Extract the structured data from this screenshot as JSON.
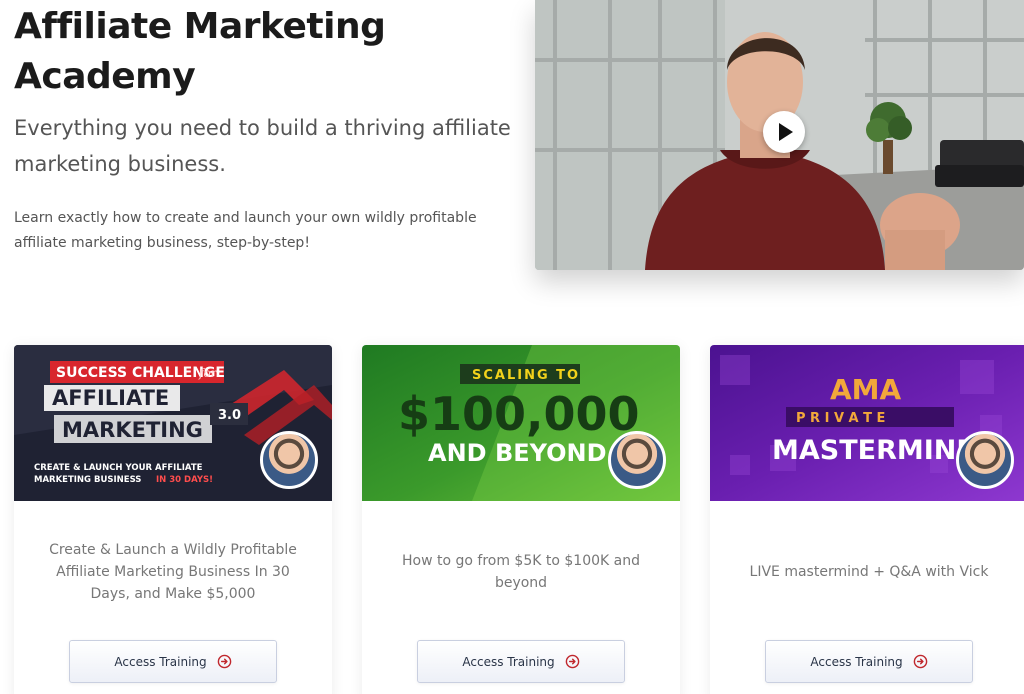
{
  "hero": {
    "title": "Affiliate Marketing Academy",
    "subtitle": "Everything you need to build a thriving affiliate marketing business.",
    "description": "Learn exactly how to create and launch your own wildly profitable affiliate marketing business, step-by-step!"
  },
  "video": {
    "play_icon": "play-icon"
  },
  "cards": [
    {
      "thumb": {
        "line1": "SUCCESS CHALLENGE",
        "line1_suffix": "for",
        "line2": "AFFILIATE",
        "line3": "MARKETING",
        "version": "3.0",
        "tagline1": "CREATE & LAUNCH YOUR AFFILIATE",
        "tagline2": "MARKETING BUSINESS",
        "tagline2_highlight": "IN 30 DAYS!"
      },
      "description": "Create & Launch a Wildly Profitable Affiliate Marketing Business In 30 Days, and Make $5,000",
      "button_label": "Access Training"
    },
    {
      "thumb": {
        "line1": "SCALING TO",
        "line2": "$100,000",
        "line3": "AND BEYOND"
      },
      "description": "How to go from $5K to $100K and beyond",
      "button_label": "Access Training"
    },
    {
      "thumb": {
        "line1": "AMA",
        "line2": "P R I V A T E",
        "line3": "MASTERMIND"
      },
      "description": "LIVE mastermind + Q&A with Vick",
      "button_label": "Access Training"
    }
  ],
  "colors": {
    "card1_bg": "#1f2233",
    "card1_red": "#d8262d",
    "card2_bg": "#3b9a2b",
    "card2_yellow": "#f2d21b",
    "card3_bg": "#6a1fb0",
    "card3_orange": "#f2a83a",
    "button_arrow": "#c0272d"
  }
}
